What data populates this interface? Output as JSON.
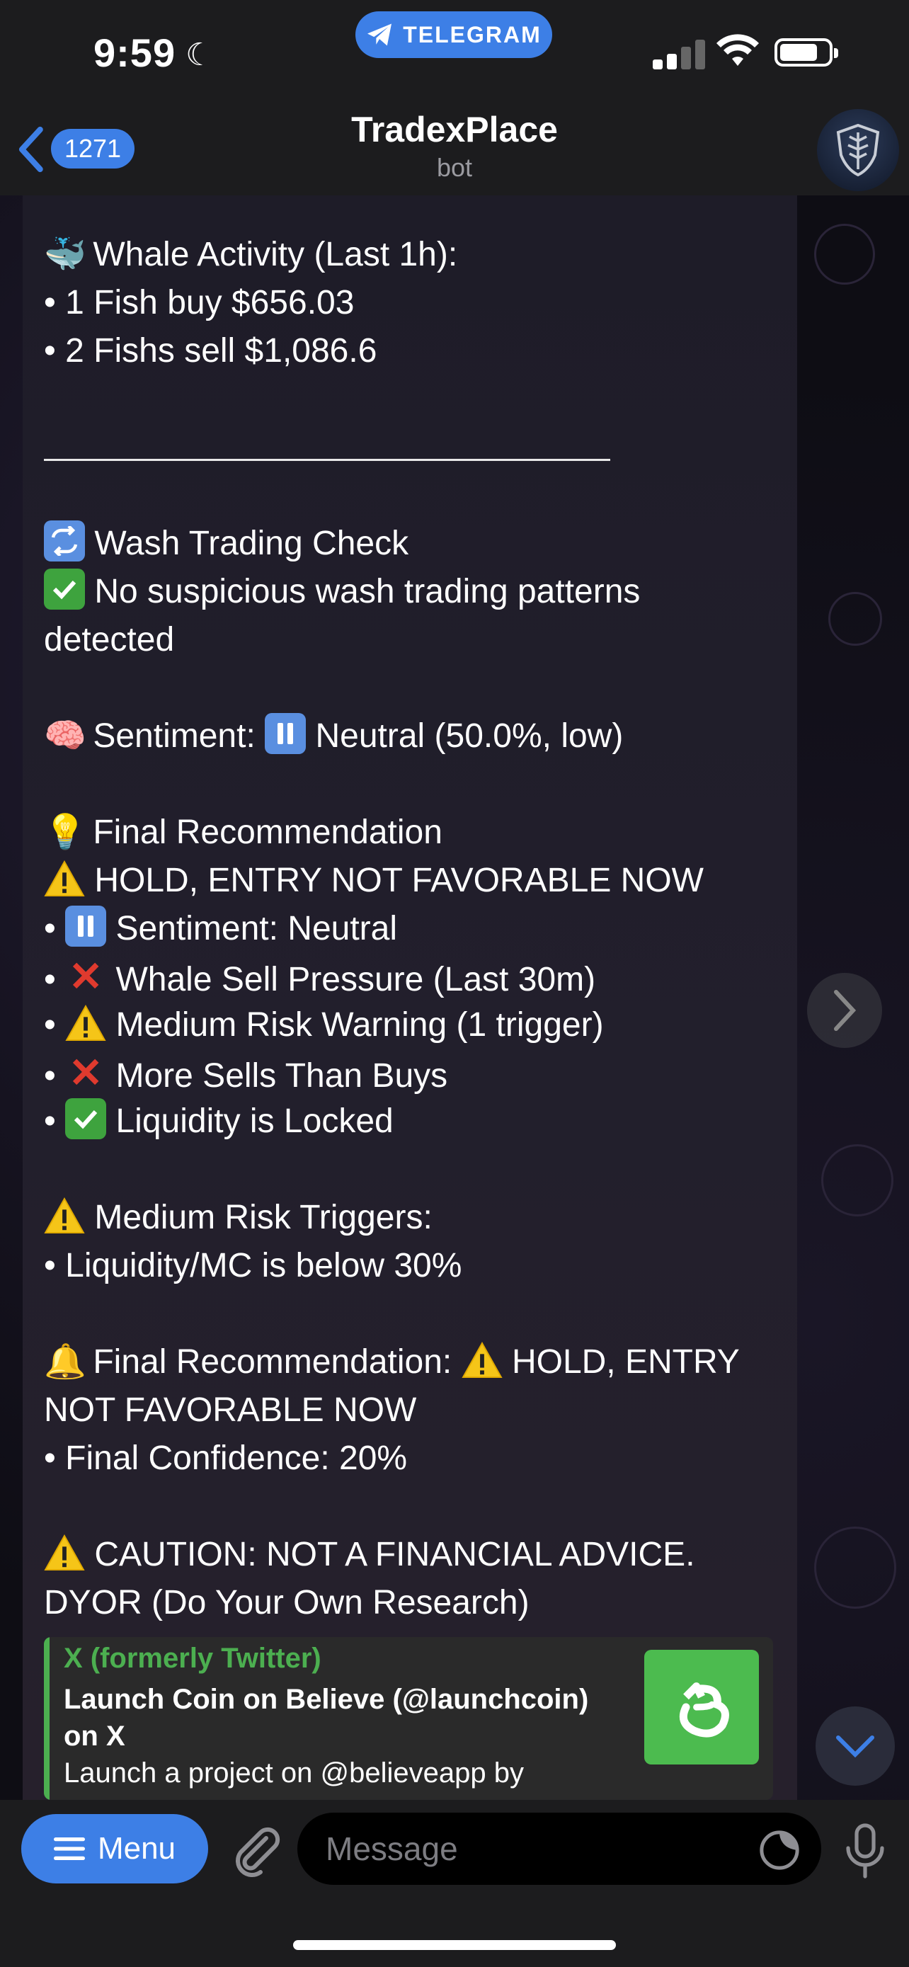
{
  "status_bar": {
    "time": "9:59",
    "app_pill": "TELEGRAM"
  },
  "header": {
    "back_count": "1271",
    "title": "TradexPlace",
    "subtitle": "bot"
  },
  "message": {
    "whale_heading": "Whale Activity (Last 1h):",
    "whale_buy": "• 1 Fish buy $656.03",
    "whale_sell": "• 2 Fishs sell $1,086.6",
    "wash_heading": "Wash Trading Check",
    "wash_result_1": "No suspicious wash trading patterns",
    "wash_result_2": "detected",
    "sentiment_label": "Sentiment:",
    "sentiment_value": "Neutral (50.0%, low)",
    "final_rec_heading": "Final Recommendation",
    "hold_line": "HOLD, ENTRY NOT FAVORABLE NOW",
    "reasons": [
      "Sentiment: Neutral",
      "Whale Sell Pressure (Last 30m)",
      "Medium Risk Warning (1 trigger)",
      "More Sells Than Buys",
      "Liquidity is Locked"
    ],
    "risk_heading": "Medium Risk Triggers:",
    "risk_item": "• Liquidity/MC is below 30%",
    "final_rec_label": "Final Recommendation:",
    "final_rec_value": "HOLD, ENTRY",
    "final_rec_value_2": "NOT FAVORABLE NOW",
    "confidence": "• Final Confidence: 20%",
    "caution_1": "CAUTION: NOT A FINANCIAL ADVICE.",
    "caution_2": "DYOR (Do Your Own Research)"
  },
  "link_preview": {
    "site": "X (formerly Twitter)",
    "title": "Launch Coin on Believe (@launchcoin) on X",
    "description": "Launch a project on @believeapp by"
  },
  "input_bar": {
    "menu_label": "Menu",
    "placeholder": "Message"
  }
}
